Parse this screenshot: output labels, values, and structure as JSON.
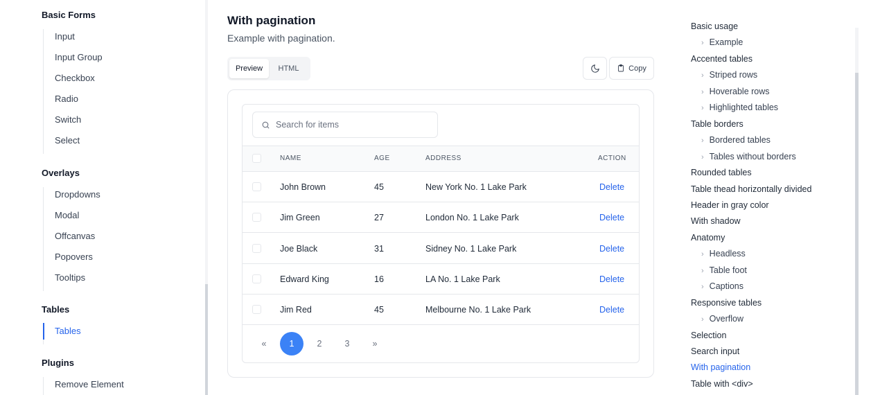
{
  "sidebar": {
    "groups": [
      {
        "title": "Basic Forms",
        "items": [
          "Input",
          "Input Group",
          "Checkbox",
          "Radio",
          "Switch",
          "Select"
        ]
      },
      {
        "title": "Overlays",
        "items": [
          "Dropdowns",
          "Modal",
          "Offcanvas",
          "Popovers",
          "Tooltips"
        ]
      },
      {
        "title": "Tables",
        "items": [
          "Tables"
        ],
        "active": "Tables"
      },
      {
        "title": "Plugins",
        "items": [
          "Remove Element"
        ]
      }
    ]
  },
  "main": {
    "title": "With pagination",
    "description": "Example with pagination.",
    "tabs": {
      "preview": "Preview",
      "html": "HTML"
    },
    "copy_label": "Copy",
    "search": {
      "placeholder": "Search for items"
    },
    "columns": {
      "name": "NAME",
      "age": "AGE",
      "address": "ADDRESS",
      "action": "ACTION"
    },
    "rows": [
      {
        "name": "John Brown",
        "age": "45",
        "address": "New York No. 1 Lake Park",
        "action": "Delete"
      },
      {
        "name": "Jim Green",
        "age": "27",
        "address": "London No. 1 Lake Park",
        "action": "Delete"
      },
      {
        "name": "Joe Black",
        "age": "31",
        "address": "Sidney No. 1 Lake Park",
        "action": "Delete"
      },
      {
        "name": "Edward King",
        "age": "16",
        "address": "LA No. 1 Lake Park",
        "action": "Delete"
      },
      {
        "name": "Jim Red",
        "age": "45",
        "address": "Melbourne No. 1 Lake Park",
        "action": "Delete"
      }
    ],
    "pagination": {
      "prev": "«",
      "pages": [
        "1",
        "2",
        "3"
      ],
      "current": "1",
      "next": "»"
    }
  },
  "toc": {
    "items": [
      {
        "label": "Basic usage",
        "sub": false
      },
      {
        "label": "Example",
        "sub": true
      },
      {
        "label": "Accented tables",
        "sub": false
      },
      {
        "label": "Striped rows",
        "sub": true
      },
      {
        "label": "Hoverable rows",
        "sub": true
      },
      {
        "label": "Highlighted tables",
        "sub": true
      },
      {
        "label": "Table borders",
        "sub": false
      },
      {
        "label": "Bordered tables",
        "sub": true
      },
      {
        "label": "Tables without borders",
        "sub": true
      },
      {
        "label": "Rounded tables",
        "sub": false
      },
      {
        "label": "Table thead horizontally divided",
        "sub": false
      },
      {
        "label": "Header in gray color",
        "sub": false
      },
      {
        "label": "With shadow",
        "sub": false
      },
      {
        "label": "Anatomy",
        "sub": false
      },
      {
        "label": "Headless",
        "sub": true
      },
      {
        "label": "Table foot",
        "sub": true
      },
      {
        "label": "Captions",
        "sub": true
      },
      {
        "label": "Responsive tables",
        "sub": false
      },
      {
        "label": "Overflow",
        "sub": true
      },
      {
        "label": "Selection",
        "sub": false
      },
      {
        "label": "Search input",
        "sub": false
      },
      {
        "label": "With pagination",
        "sub": false,
        "active": true
      },
      {
        "label": "Table with <div>",
        "sub": false
      }
    ],
    "chevron": "›"
  },
  "colors": {
    "accent": "#2563eb",
    "page_active": "#3b82f6",
    "border": "#e5e7eb"
  },
  "icons": {
    "theme": "moon-icon",
    "copy": "clipboard-icon",
    "search": "search-icon"
  }
}
